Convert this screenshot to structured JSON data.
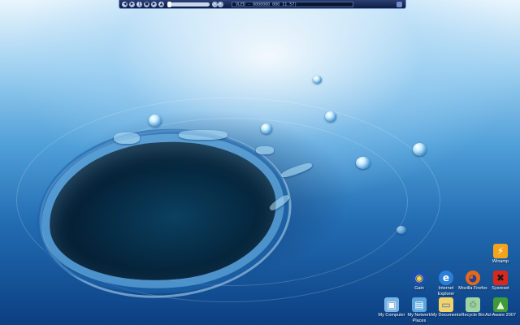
{
  "desktop": {
    "wallpaper": "water-splash",
    "colors": {
      "deep": "#0b3f82",
      "mid": "#4f9fd8",
      "light": "#e9f5fd"
    }
  },
  "player": {
    "display_text": "VLED - 0000000 000 11.57)",
    "buttons": [
      "previous-icon",
      "play-icon",
      "pause-icon",
      "stop-icon",
      "next-icon",
      "eject-icon"
    ]
  },
  "icons": [
    {
      "name": "winamp",
      "label": "Winamp",
      "glyph": "⚡",
      "bg": "#f2a31b",
      "fg": "#ffffff"
    },
    {
      "name": "gain",
      "label": "Gain",
      "glyph": "◉",
      "bg": "#1b4fb5",
      "fg": "#ffd23a"
    },
    {
      "name": "internet-explorer",
      "label": "Internet Explorer",
      "glyph": "e",
      "bg": "#2b7fd6",
      "fg": "#ffffff"
    },
    {
      "name": "mozilla-firefox",
      "label": "Mozilla Firefox",
      "glyph": "◕",
      "bg": "#e36a1c",
      "fg": "#2a3f8f"
    },
    {
      "name": "sysreset",
      "label": "Sysreset",
      "glyph": "✖",
      "bg": "#d9281e",
      "fg": "#1b1b1b"
    },
    {
      "name": "my-computer",
      "label": "My Computer",
      "glyph": "▣",
      "bg": "#7ab3e6",
      "fg": "#ffffff"
    },
    {
      "name": "my-network-places",
      "label": "My Network Places",
      "glyph": "▤",
      "bg": "#5aa5df",
      "fg": "#ffffff"
    },
    {
      "name": "my-documents",
      "label": "My Documents",
      "glyph": "▭",
      "bg": "#f1d36a",
      "fg": "#3a6fc4"
    },
    {
      "name": "recycle-bin",
      "label": "Recycle Bin",
      "glyph": "♲",
      "bg": "#9fd3a6",
      "fg": "#1e6b2a"
    },
    {
      "name": "ad-aware-2007",
      "label": "Ad-Aware 2007",
      "glyph": "▲",
      "bg": "#3f9a3a",
      "fg": "#e9f8cf"
    }
  ]
}
